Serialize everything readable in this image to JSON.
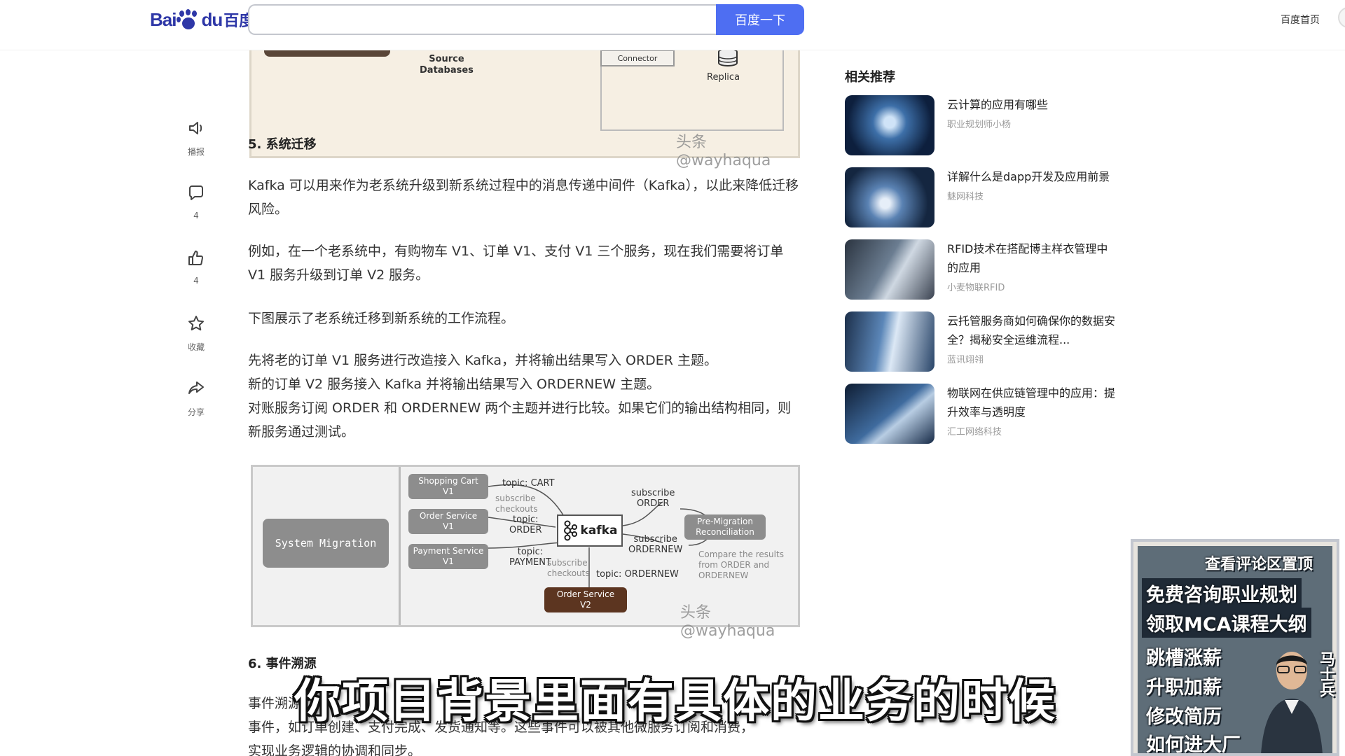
{
  "header": {
    "logo_text_left": "Bai",
    "logo_text_right": "du",
    "logo_text_cn": "百度",
    "search_value": "",
    "search_button": "百度一下",
    "home_link": "百度首页"
  },
  "rail": [
    {
      "icon": "speaker-icon",
      "label": "播报"
    },
    {
      "icon": "comment-icon",
      "label": "4"
    },
    {
      "icon": "thumbs-up-icon",
      "label": "4"
    },
    {
      "icon": "star-icon",
      "label": "收藏"
    },
    {
      "icon": "share-icon",
      "label": "分享"
    }
  ],
  "figure_top": {
    "source_label": "Source\nDatabases",
    "connector_label": "Connector",
    "replica_label": "Replica",
    "watermark": "头条 @wayhaqua"
  },
  "article": {
    "section5_heading": "5. 系统迁移",
    "p1": "Kafka 可以用来作为老系统升级到新系统过程中的消息传递中间件（Kafka），以此来降低迁移风险。",
    "p2": "例如，在一个老系统中，有购物车 V1、订单 V1、支付 V1 三个服务，现在我们需要将订单 V1 服务升级到订单 V2 服务。",
    "p3": "下图展示了老系统迁移到新系统的工作流程。",
    "p4": "先将老的订单 V1 服务进行改造接入 Kafka，并将输出结果写入 ORDER 主题。",
    "p5": "新的订单 V2 服务接入 Kafka 并将输出结果写入 ORDERNEW 主题。",
    "p6": "对账服务订阅 ORDER 和 ORDERNEW 两个主题并进行比较。如果它们的输出结构相同，则新服务通过测试。",
    "section6_heading": "6. 事件溯源",
    "p7": "事件溯源",
    "p8": "事件，如订单创建、支付完成、发货通知等。这些事件可以被其他微服务订阅和消费，",
    "p9": "实现业务逻辑的协调和同步。"
  },
  "migration_figure": {
    "system_migration": "System Migration",
    "shopping_cart": "Shopping Cart\nV1",
    "order_service_v1": "Order Service\nV1",
    "payment_service": "Payment Service\nV1",
    "order_service_v2": "Order Service\nV2",
    "kafka": "kafka",
    "pre_migration": "Pre-Migration\nReconciliation",
    "topic_cart": "topic: CART",
    "subscribe_checkouts_1": "subscribe\ncheckouts",
    "topic_order": "topic:\nORDER",
    "topic_payment": "topic:\nPAYMENT",
    "subscribe_checkouts_2": "subscribe\ncheckouts",
    "topic_ordernew": "topic: ORDERNEW",
    "subscribe_order": "subscribe\nORDER",
    "subscribe_ordernew": "subscribe\nORDERNEW",
    "compare_note": "Compare the results\nfrom ORDER and\nORDERNEW",
    "watermark": "头条 @wayhaqua"
  },
  "related": {
    "title": "相关推荐",
    "items": [
      {
        "title": "云计算的应用有哪些",
        "source": "职业规划师小杨"
      },
      {
        "title": "详解什么是dapp开发及应用前景",
        "source": "魅网科技"
      },
      {
        "title": "RFID技术在搭配博主样衣管理中的应用",
        "source": "小麦物联RFID"
      },
      {
        "title": "云托管服务商如何确保你的数据安全？揭秘安全运维流程...",
        "source": "蓝讯翊翎"
      },
      {
        "title": "物联网在供应链管理中的应用：提升效率与透明度",
        "source": "汇工网络科技"
      }
    ]
  },
  "ad": {
    "top": "查看评论区置顶",
    "line1": "免费咨询职业规划",
    "line2": "领取MCA课程大纲",
    "line3": "跳槽涨薪",
    "line4": "升职加薪",
    "line5": "修改简历",
    "line6": "如何进大厂",
    "name": "马士兵"
  },
  "subtitle": "你项目背景里面有具体的业务的时候",
  "colors": {
    "brand_blue": "#2e37a7",
    "search_button": "#4e6ef2",
    "subtitle_text": "#ffffff"
  }
}
